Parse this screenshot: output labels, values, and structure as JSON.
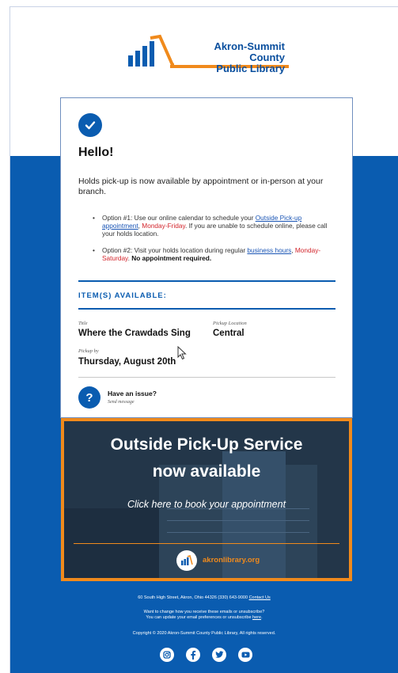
{
  "header": {
    "logo_line1": "Akron-Summit County",
    "logo_line2": "Public Library"
  },
  "card": {
    "greeting": "Hello!",
    "intro": "Holds pick-up is now available by appointment or in-person at your branch.",
    "option1": {
      "prefix": "Option #1: Use our online calendar to schedule your ",
      "link": "Outside Pick-up appointment",
      "sep": ", ",
      "days": "Monday-Friday",
      "suffix": ". If you are unable to schedule online, please call your holds location."
    },
    "option2": {
      "prefix": "Option #2: Visit your holds location during regular ",
      "link": "business hours",
      "sep": ", ",
      "days": "Monday-Saturday",
      "sep2": ". ",
      "bold": "No appointment required."
    },
    "items_heading": "ITEM(S) AVAILABLE:",
    "item": {
      "title_label": "Title",
      "title": "Where the Crawdads Sing",
      "location_label": "Pickup Location",
      "location": "Central",
      "pickup_by_label": "Pickup by",
      "pickup_by": "Thursday, August 20th"
    },
    "issue": {
      "title": "Have an issue?",
      "subtitle": "Send message"
    }
  },
  "banner": {
    "line1": "Outside Pick-Up Service",
    "line2": "now available",
    "cta": "Click here to book your appointment",
    "url": "akronlibrary.org"
  },
  "footer": {
    "address": "60 South High Street, Akron, Ohio 44326 (330) 643-9000 ",
    "contact_link": "Contact Us",
    "change_line": "Want to change how you receive these emails or unsubscribe?",
    "update_line": "You can update your email preferences or unsubscribe ",
    "here_link": "here",
    "period": ".",
    "copyright": "Copyright © 2020 Akron-Summit County Public Library, All rights reserved."
  },
  "colors": {
    "brand_blue": "#0a5cb0",
    "accent_orange": "#f08a1c",
    "alert_red": "#d2232a"
  },
  "icons": [
    "checkmark-icon",
    "question-icon",
    "library-logo-icon",
    "instagram-icon",
    "facebook-icon",
    "twitter-icon",
    "youtube-icon",
    "mouse-cursor-icon"
  ]
}
